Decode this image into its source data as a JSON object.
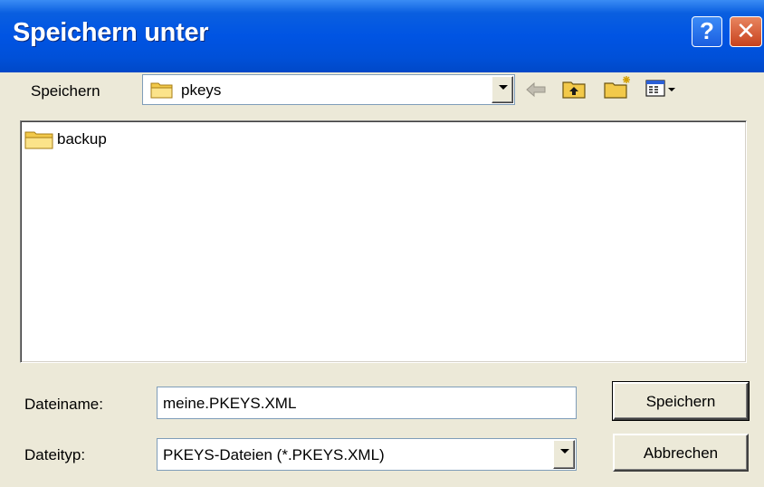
{
  "window": {
    "title": "Speichern unter",
    "help_icon": "?",
    "close_icon": "✕"
  },
  "toolbar": {
    "save_in_label": "Speichern",
    "location": "pkeys",
    "icons": [
      "back-arrow-icon",
      "up-folder-icon",
      "new-folder-icon",
      "view-menu-icon"
    ]
  },
  "files": [
    {
      "name": "backup",
      "type": "folder"
    }
  ],
  "form": {
    "filename_label": "Dateiname:",
    "filename_value": "meine.PKEYS.XML",
    "filetype_label": "Dateityp:",
    "filetype_value": "PKEYS-Dateien (*.PKEYS.XML)"
  },
  "buttons": {
    "save": "Speichern",
    "cancel": "Abbrechen"
  }
}
